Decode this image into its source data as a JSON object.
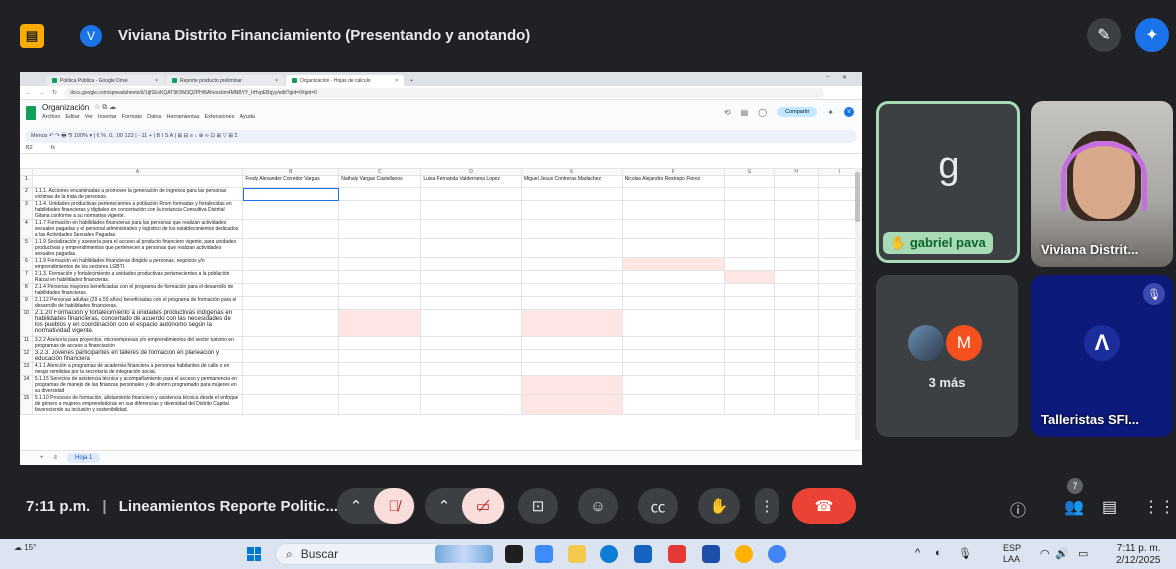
{
  "meet": {
    "presenter_initial": "V",
    "presenter_title": "Viviana Distrito Financiamiento (Presentando y anotando)",
    "time": "7:11 p.m.",
    "separator": "|",
    "meeting_title": "Lineamientos Reporte Politic...",
    "participant_count": "7"
  },
  "tiles": {
    "gabriel": {
      "letter": "g",
      "label": "gabriel pava"
    },
    "viviana": {
      "label": "Viviana Distrit..."
    },
    "more": {
      "initial": "M",
      "label": "3 más"
    },
    "talleristas": {
      "label": "Talleristas SFI..."
    }
  },
  "browser": {
    "tabs": [
      {
        "label": "Política Pública - Google Drive",
        "color": "#0f9d58"
      },
      {
        "label": "Reporte producto preliminar",
        "color": "#0f9d58"
      },
      {
        "label": "Organización - Hojas de cálculo",
        "color": "#0f9d58"
      }
    ],
    "url": "docs.google.com/spreadsheets/d/1tjf1ExKQAT9K5M3Q2PHI8Ahesxbm4MNBYY_hHvpEBqyy/edit?gid=0#gid=0"
  },
  "sheets": {
    "doc_title": "Organización",
    "menu": [
      "Archivo",
      "Editar",
      "Ver",
      "Insertar",
      "Formato",
      "Datos",
      "Herramientas",
      "Extensiones",
      "Ayuda"
    ],
    "share_label": "Compartir",
    "user_initial": "V",
    "toolbar_text": "Menús   ↶  ↷  🖶  ⅋   100%  ▾  |  €   %   .0,   .00   123   |   -   11   +  |  B   I   S   A  |  ⊞   ⊟  ≡  ↓  ⊕  ∞  ⊡  ⊞  ▽  ⊞  Σ",
    "cell_ref": "B2",
    "fx": "fx",
    "col_letters": [
      "",
      "A",
      "B",
      "C",
      "D",
      "E",
      "F",
      "G",
      "H",
      "I"
    ],
    "col_names": [
      "Fredy Alexander Corredor Vargas",
      "Nathaly Vargas Castellanos",
      "Luisa Fernanda Valderrama Lopez",
      "Miguel Jesus Contreras Madachez",
      "Nicolas Alejandro Restrepo Florez"
    ],
    "rows": [
      {
        "num": "1",
        "text": ""
      },
      {
        "num": "2",
        "text": "1.1.1. Acciones encaminadas a promover la generación de ingresos para las personas víctimas de la trata de personas."
      },
      {
        "num": "3",
        "text": "1.1.4. Unidades productivas pertenecientes a población Rrom formadas y fortalecidas en habilidades financieras y digitales en concertación con la instancia Consultiva Distrital Gitana conforme a su normativa vigente."
      },
      {
        "num": "4",
        "text": "1.1.7 Formación en habilidades financieras para las personas que realizan actividades sexuales pagadas y el personal administrativo y logístico de los establecimientos dedicados a las Actividades Sexuales Pagadas."
      },
      {
        "num": "5",
        "text": "1.1.9 Socialización y asesoría para el acceso al producto financiero vigente, para unidades productivas y emprendimientos que pertenecen a personas que realizan actividades sexuales pagadas."
      },
      {
        "num": "6",
        "text": "1.1.9 Formación en habilidades financieras dirigido a personas, negocios y/o emprendimientos de los sectores LGBTI."
      },
      {
        "num": "7",
        "text": "2.1.3. Formación y fortalecimiento a unidades productivas pertenecientes a la población Raizal en habilidades financieras."
      },
      {
        "num": "8",
        "text": "2.1.4 Personas mayores beneficiadas con el programa de formación para el desarrollo de habilidades financieras."
      },
      {
        "num": "9",
        "text": "2.1.12 Personas adultas (29 a 59 años) beneficiadas con el programa de formación para el desarrollo de habilidades financieras."
      },
      {
        "num": "10",
        "text": "2.1.20 Formación y fortalecimiento a unidades productivas indígenas en habilidades financieras, concertado de acuerdo con las necesidades de los pueblos y en coordinación con el espacio autónomo según la normatividad vigente."
      },
      {
        "num": "11",
        "text": "3.2.2 Asesoría para proyectos, microempresas y/o emprendimientos del sector turismo en programas de acceso a financiación"
      },
      {
        "num": "12",
        "text": "3.2.3. Jóvenes participantes en talleres de formación en planeación y educación financiera"
      },
      {
        "num": "13",
        "text": "4.1.1 Atención a programas de academia financiera a personas habitantes de calle o en riesgo remitidas por la secretaría de integración social."
      },
      {
        "num": "14",
        "text": "5.1.15 Servicios de asistencia técnica y acompañamiento para el acceso y permanencia en programas de manejo de las finanzas personales y de ahorro programado para mujeres en su diversidad"
      },
      {
        "num": "15",
        "text": "5.1.10 Procesos de formación, alistamiento financiero y asistencia técnica desde el enfoque de género a mujeres emprendedoras en sus diferencias y diversidad del Distrito Capital favoreciendo su inclusión y sostenibilidad."
      }
    ],
    "sheet_tab": "Hoja 1"
  },
  "taskbar": {
    "temp": "15°",
    "search_placeholder": "Buscar",
    "lang": "ESP",
    "lang2": "LAA",
    "time": "7:11 p. m.",
    "date": "2/12/2025"
  },
  "colors": {
    "accent": "#1a73e8",
    "hangup": "#ea4335",
    "highlight": "#a8dab5",
    "pink_cell": "#fde6e4"
  }
}
